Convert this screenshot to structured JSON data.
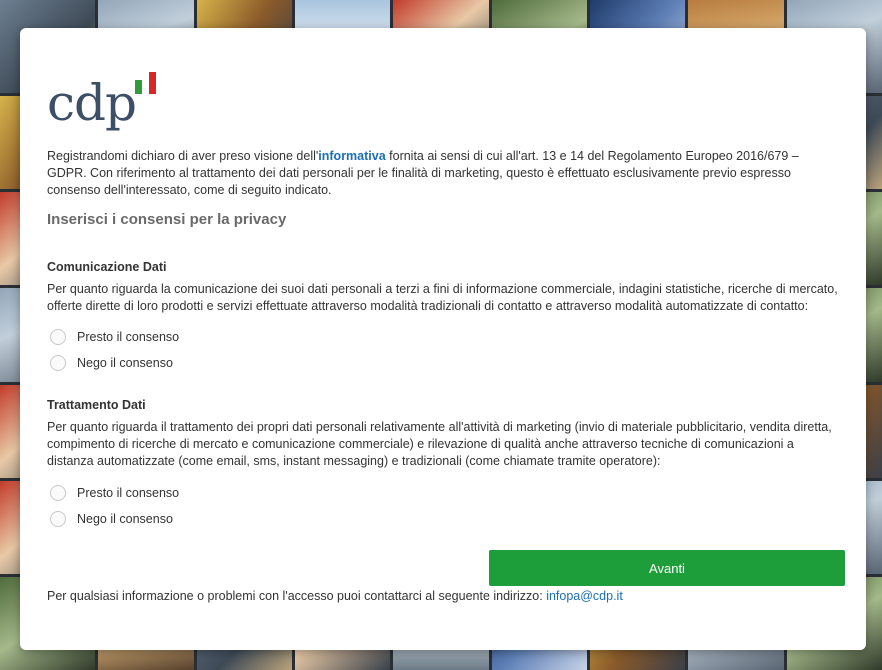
{
  "brand": {
    "logo_text": "cdp",
    "flag_colors": [
      "#2f9b3a",
      "#ffffff",
      "#d62828"
    ]
  },
  "intro": {
    "before_link": "Registrandomi dichiaro di aver preso visione dell'",
    "link_text": "informativa",
    "after_link": " fornita ai sensi di cui all'art. 13 e 14 del Regolamento Europeo 2016/679 – GDPR. Con riferimento al trattamento dei dati personali per le finalità di marketing, questo è effettuato esclusivamente previo espresso consenso dell'interessato, come di seguito indicato."
  },
  "section_title": "Inserisci i consensi per la privacy",
  "blocks": [
    {
      "title": "Comunicazione Dati",
      "text": "Per quanto riguarda la comunicazione dei suoi dati personali a terzi a fini di informazione commerciale, indagini statistiche, ricerche di mercato, offerte dirette di loro prodotti e servizi effettuate attraverso modalità tradizionali di contatto e attraverso modalità automatizzate di contatto:",
      "options": [
        "Presto il consenso",
        "Nego il consenso"
      ]
    },
    {
      "title": "Trattamento Dati",
      "text": "Per quanto riguarda il trattamento dei propri dati personali relativamente all'attività di marketing (invio di materiale pubblicitario, vendita diretta, compimento di ricerche di mercato e comunicazione commerciale) e rilevazione di qualità anche attraverso tecniche di comunicazioni a distanza automatizzate (come email, sms, instant messaging) e tradizionali (come chiamate tramite operatore):",
      "options": [
        "Presto il consenso",
        "Nego il consenso"
      ]
    }
  ],
  "next_button": "Avanti",
  "footer": {
    "text": "Per qualsiasi informazione o problemi con l'accesso puoi contattarci al seguente indirizzo: ",
    "email": "infopa@cdp.it"
  },
  "colors": {
    "accent_green": "#1e9e3b",
    "link_blue": "#1b6fb5",
    "logo_navy": "#3d4f67"
  }
}
